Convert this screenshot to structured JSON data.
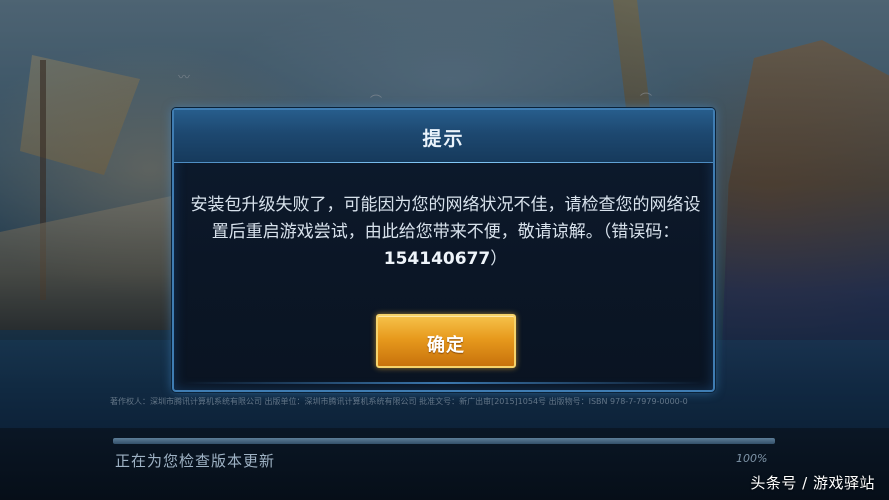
{
  "dialog": {
    "title": "提示",
    "message_text": "安装包升级失败了，可能因为您的网络状况不佳，请检查您的网络设置后重启游戏尝试，由此给您带来不便，敬请谅解。（错误码：",
    "error_code": "154140677",
    "message_suffix": "）",
    "confirm_label": "确定"
  },
  "loading": {
    "status_text": "正在为您检查版本更新",
    "progress_percent": 100,
    "percent_label": "100%"
  },
  "footer": {
    "copyright": "著作权人：深圳市腾讯计算机系统有限公司  出版单位：深圳市腾讯计算机系统有限公司  批准文号：新广出审[2015]1054号  出版物号：ISBN 978-7-7979-0000-0"
  },
  "watermark": "头条号 / 游戏驿站",
  "colors": {
    "dialog_border": "#3f7db3",
    "dialog_header": "#1d4870",
    "confirm_button": "#e79a1d",
    "progress_fill": "#5d7e98"
  }
}
